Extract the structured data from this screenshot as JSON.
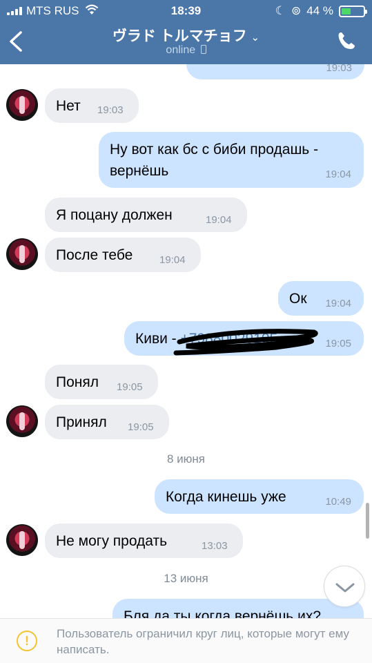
{
  "status_bar": {
    "carrier": "MTS RUS",
    "time": "18:39",
    "battery": "44 %",
    "battery_level": 0.44
  },
  "header": {
    "name": "ヴラド トルマチョフ",
    "status": "online"
  },
  "messages": [
    {
      "text": "Нет",
      "time": "19:03"
    },
    {
      "text": "Ну вот как бс с биби продашь - вернёшь",
      "time": "19:04"
    },
    {
      "text": "Я поцану должен",
      "time": "19:04"
    },
    {
      "text": "После тебе",
      "time": "19:04"
    },
    {
      "text": "Ок",
      "time": "19:04"
    },
    {
      "text": "Киви - ",
      "redacted": "+79880029105",
      "time": "19:05"
    },
    {
      "text": "Понял",
      "time": "19:05"
    },
    {
      "text": "Принял",
      "time": "19:05"
    },
    {
      "text": "Когда кинешь уже",
      "time": "10:49"
    },
    {
      "text": "Не могу продать",
      "time": "13:03"
    },
    {
      "text": "Бля да ты когда вернёшь их?"
    }
  ],
  "top_partial_time": "19:03",
  "dates": [
    "8 июня",
    "13 июня"
  ],
  "footer": {
    "notice": "Пользователь ограничил круг лиц, которые могут ему написать."
  },
  "colors": {
    "header": "#4a76a8",
    "incoming_bubble": "#ebedf0",
    "outgoing_bubble": "#cce4ff",
    "warning": "#f5c330"
  }
}
